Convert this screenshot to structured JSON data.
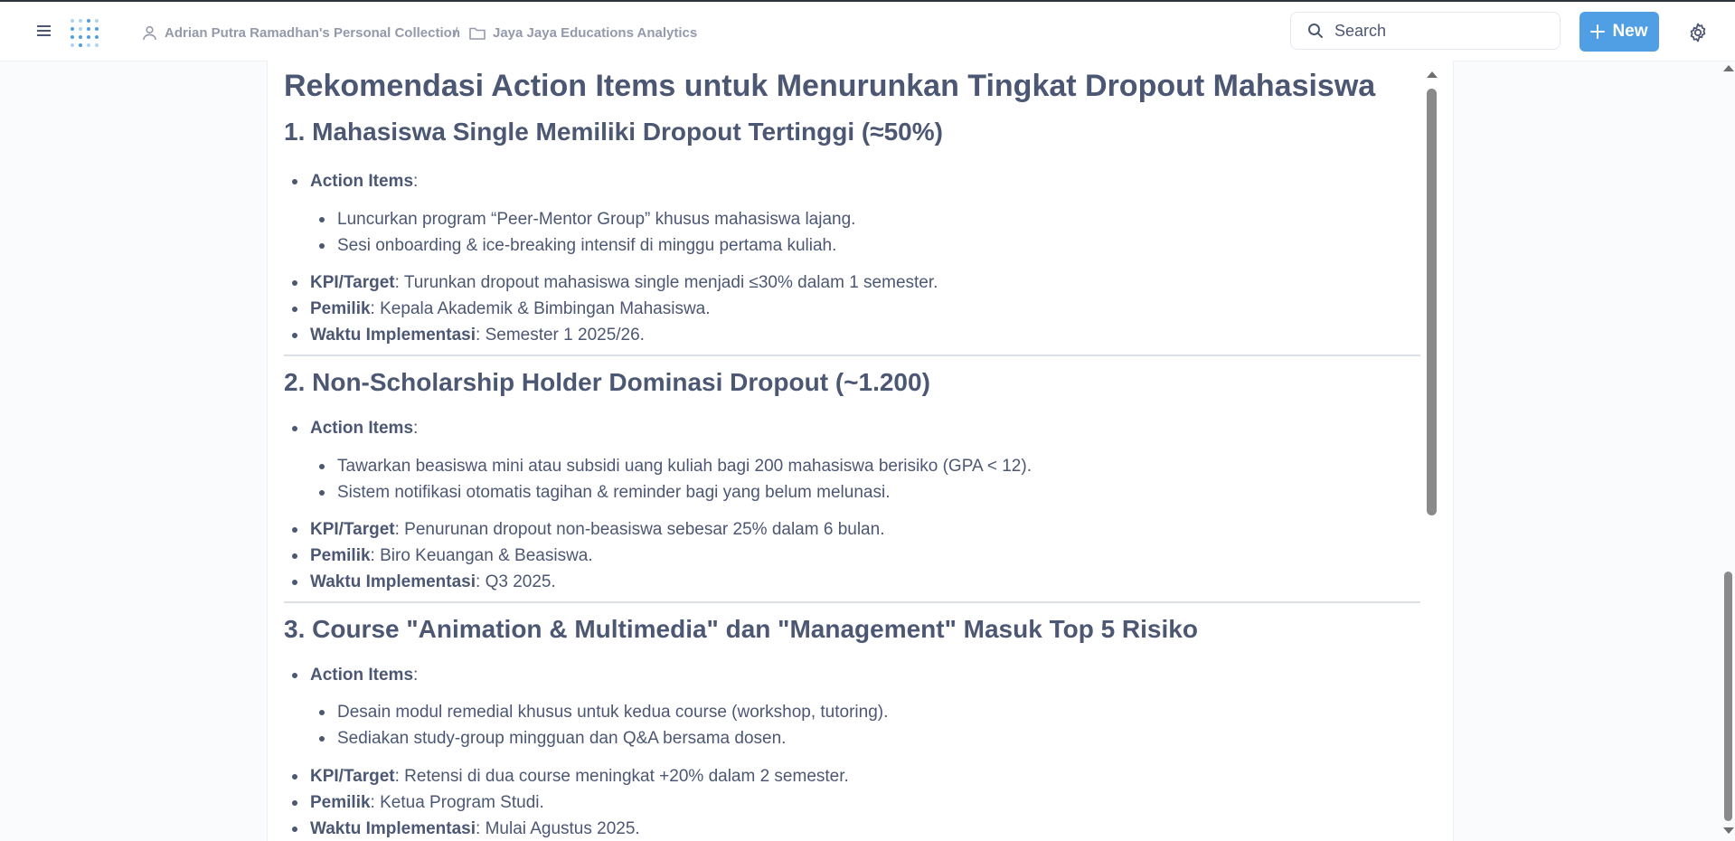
{
  "breadcrumb": {
    "collection": "Adrian Putra Ramadhan's Personal Collection",
    "separator": "/",
    "folder": "Jaya Jaya Educations Analytics"
  },
  "search": {
    "placeholder": "Search"
  },
  "new_button": {
    "label": "New"
  },
  "colors": {
    "accent": "#509ee3",
    "text": "#4c5773",
    "muted": "#949aab"
  },
  "doc": {
    "title": "Rekomendasi Action Items untuk Menurunkan Tingkat Dropout Mahasiswa",
    "sections": [
      {
        "title": "1. Mahasiswa Single Memiliki Dropout Tertinggi (≈50%)",
        "action_label": "Action Items",
        "actions": [
          "Luncurkan program “Peer-Mentor Group” khusus mahasiswa lajang.",
          "Sesi onboarding & ice-breaking intensif di minggu pertama kuliah."
        ],
        "kpi_label": "KPI/Target",
        "kpi": ": Turunkan dropout mahasiswa single menjadi ≤30% dalam 1 semester.",
        "owner_label": "Pemilik",
        "owner": ": Kepala Akademik & Bimbingan Mahasiswa.",
        "time_label": "Waktu Implementasi",
        "time": ": Semester 1 2025/26."
      },
      {
        "title": "2. Non-Scholarship Holder Dominasi Dropout (~1.200)",
        "action_label": "Action Items",
        "actions": [
          "Tawarkan beasiswa mini atau subsidi uang kuliah bagi 200 mahasiswa berisiko (GPA < 12).",
          "Sistem notifikasi otomatis tagihan & reminder bagi yang belum melunasi."
        ],
        "kpi_label": "KPI/Target",
        "kpi": ": Penurunan dropout non-beasiswa sebesar 25% dalam 6 bulan.",
        "owner_label": "Pemilik",
        "owner": ": Biro Keuangan & Beasiswa.",
        "time_label": "Waktu Implementasi",
        "time": ": Q3 2025."
      },
      {
        "title": "3. Course \"Animation & Multimedia\" dan \"Management\" Masuk Top 5 Risiko",
        "action_label": "Action Items",
        "actions": [
          "Desain modul remedial khusus untuk kedua course (workshop, tutoring).",
          "Sediakan study-group mingguan dan Q&A bersama dosen."
        ],
        "kpi_label": "KPI/Target",
        "kpi": ": Retensi di dua course meningkat +20% dalam 2 semester.",
        "owner_label": "Pemilik",
        "owner": ": Ketua Program Studi.",
        "time_label": "Waktu Implementasi",
        "time": ": Mulai Agustus 2025."
      }
    ]
  }
}
